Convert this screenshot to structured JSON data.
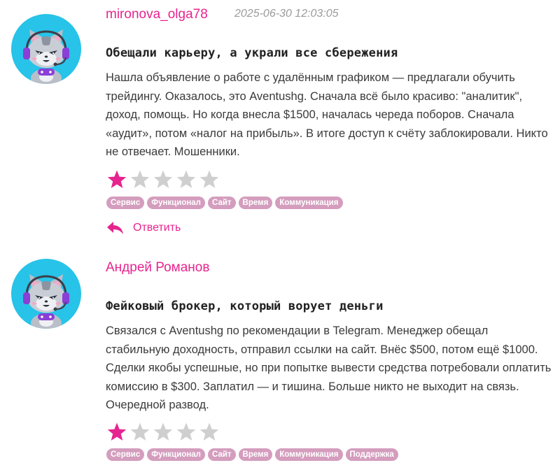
{
  "colors": {
    "accent": "#e6248f",
    "tag_bg": "#d49dbd",
    "avatar_bg": "#27c3e8",
    "star_on": "#e6248f",
    "star_off": "#cfcfcf"
  },
  "reviews": [
    {
      "author": "mironova_olga78",
      "date": "2025-06-30 12:03:05",
      "title": "Обещали карьеру, а украли все сбережения",
      "body": "Нашла объявление о работе с удалённым графиком — предлагали обучить трейдингу. Оказалось, это Aventushg. Сначала всё было красиво: \"аналитик\", доход, помощь. Но когда внесла $1500, началась череда поборов. Сначала «аудит», потом «налог на прибыль». В итоге доступ к счёту заблокировали. Никто не отвечает. Мошенники.",
      "rating": 1,
      "max_rating": 5,
      "tags": [
        "Сервис",
        "Функционал",
        "Сайт",
        "Время",
        "Коммуникация"
      ],
      "reply_label": "Ответить",
      "avatar_icon": "cat-gamer-avatar-icon"
    },
    {
      "author": "Андрей Романов",
      "title": "Фейковый брокер, который ворует деньги",
      "body": "Связался с Aventushg по рекомендации в Telegram. Менеджер обещал стабильную доходность, отправил ссылки на сайт. Внёс $500, потом ещё $1000. Сделки якобы успешные, но при попытке вывести средства потребовали оплатить комиссию в $300. Заплатил — и тишина. Больше никто не выходит на связь. Очередной развод.",
      "rating": 1,
      "max_rating": 5,
      "tags": [
        "Сервис",
        "Функционал",
        "Сайт",
        "Время",
        "Коммуникация",
        "Поддержка"
      ],
      "avatar_icon": "cat-gamer-avatar-icon"
    }
  ]
}
